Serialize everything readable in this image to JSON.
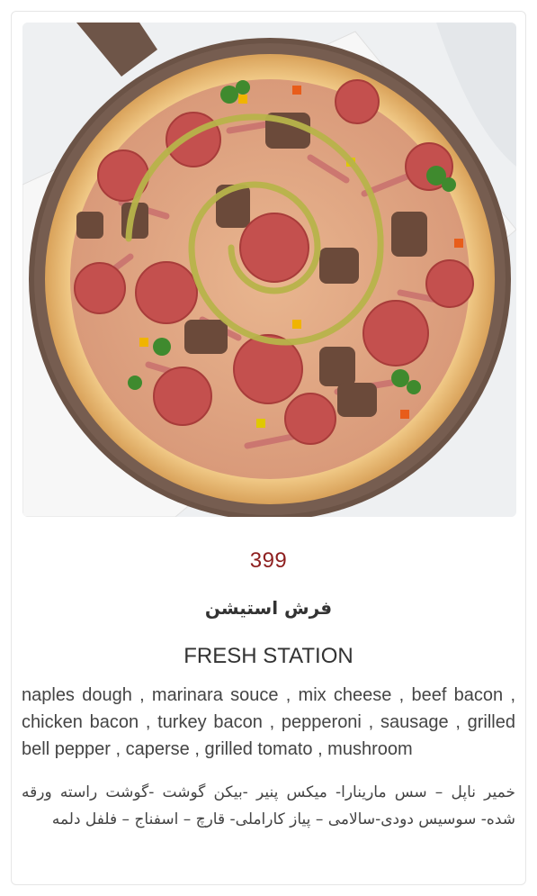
{
  "product": {
    "image_alt": "pizza-photo",
    "price": "399",
    "name_fa": "فرش استیشن",
    "name_en": "FRESH STATION",
    "description_en": "naples dough , marinara souce , mix cheese , beef bacon , chicken bacon , turkey bacon , pepperoni , sausage , grilled bell pepper , caperse , grilled tomato , mushroom",
    "description_fa": "خمیر ناپل – سس مارینارا- میکس پنیر -بیکن گوشت -گوشت راسته ورقه شده- سوسیس دودی-سالامی – پیاز کاراملی- قارچ – اسفناج – فلفل دلمه"
  },
  "colors": {
    "price": "#8e1f1f",
    "text": "#333333",
    "border": "#e6e6e6"
  }
}
